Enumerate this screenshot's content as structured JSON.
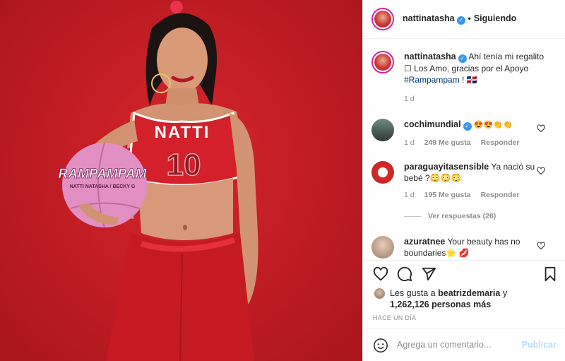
{
  "post": {
    "author": "nattinatasha",
    "follow_status": "Siguiendo",
    "jersey_text": "NATTI",
    "jersey_number": "10",
    "ball_text": "RAMPAMPAM",
    "ball_subtext": "NATTI NATASHA / BECKY G"
  },
  "caption": {
    "username": "nattinatasha",
    "text": "Ahí tenía mi regalito ☐ Los Amo, gracias por el Apoyo",
    "hashtag": "#Rampampam",
    "suffix": " ! 🇩🇴",
    "time": "1 d"
  },
  "comments": [
    {
      "username": "cochimundial",
      "text": "😍😍👏👏",
      "time": "1 d",
      "likes": "249 Me gusta",
      "reply": "Responder"
    },
    {
      "username": "paraguayitasensible",
      "text": "Ya nació su bebé ?😳😳😳",
      "time": "1 d",
      "likes": "195 Me gusta",
      "reply": "Responder"
    },
    {
      "username": "azuratnee",
      "text": "Your beauty has no boundaries🌟 💋"
    }
  ],
  "view_replies": "Ver respuestas (26)",
  "likes": {
    "prefix": "Les gusta a ",
    "user": "beatrizdemaria",
    "mid": " y",
    "count": "1,262,126 personas más"
  },
  "timestamp": "HACE UN DÍA",
  "add_comment": {
    "placeholder": "Agrega un comentario...",
    "post_label": "Publicar"
  },
  "icons": [
    "heart-icon",
    "comment-icon",
    "share-icon",
    "bookmark-icon",
    "smile-icon"
  ],
  "colors": {
    "background_red": "#c31d25",
    "link_blue": "#00376b",
    "verified_blue": "#3897f0",
    "publish_disabled": "#b3dbff"
  }
}
